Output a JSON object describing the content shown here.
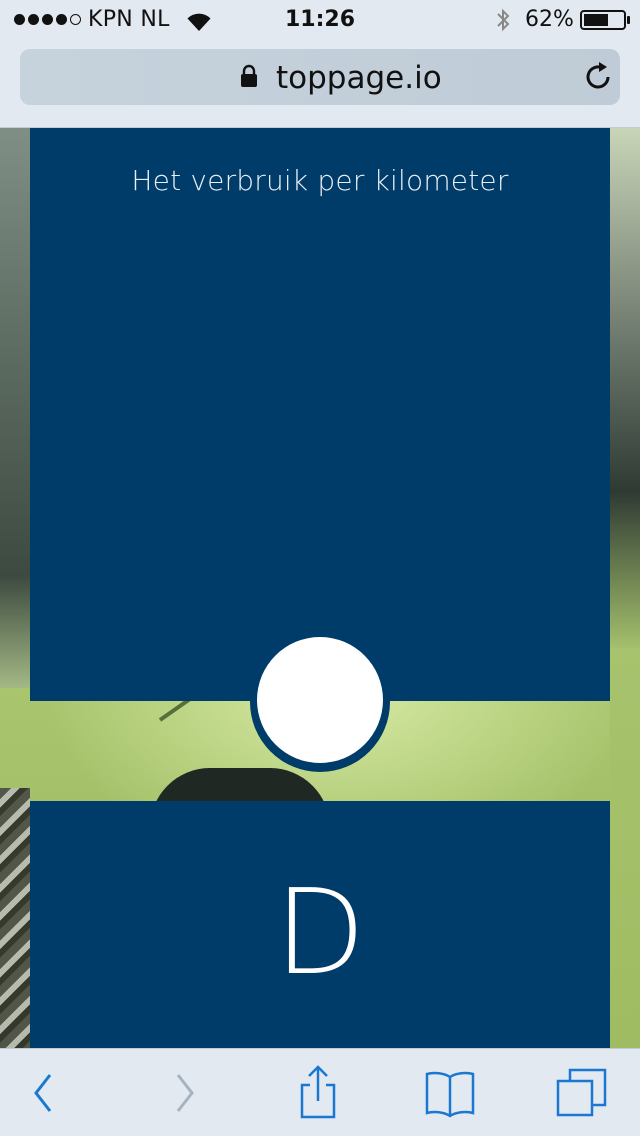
{
  "status_bar": {
    "carrier": "KPN NL",
    "time": "11:26",
    "battery": "62%",
    "signal_strength": 4,
    "signal_max": 5
  },
  "browser": {
    "url": "toppage.io"
  },
  "page": {
    "title": "Het verbruik per kilometer",
    "letter": "D"
  },
  "icons": {
    "wifi": "wifi-icon",
    "bluetooth": "bluetooth-icon",
    "battery": "battery-icon",
    "lock": "lock-icon",
    "reload": "reload-icon",
    "back": "chevron-left-icon",
    "forward": "chevron-right-icon",
    "share": "share-icon",
    "bookmarks": "book-icon",
    "tabs": "tabs-icon"
  },
  "colors": {
    "panel": "#003c69",
    "accent": "#1a78d0",
    "disabled": "#a8b3c0"
  }
}
